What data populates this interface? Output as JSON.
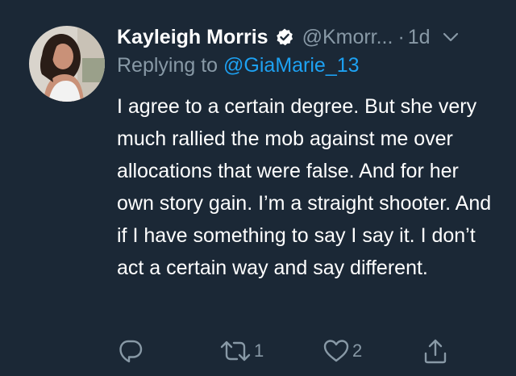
{
  "tweet": {
    "author_name": "Kayleigh Morris",
    "author_handle": "@Kmorr...",
    "separator": "·",
    "timestamp": "1d",
    "replying_prefix": "Replying to",
    "replying_handle": "@GiaMarie_13",
    "text": "I agree to a certain degree. But she very much rallied the mob against me over allocations that were false. And for her own story gain. I’m a straight shooter. And if I have something to say I say it. I don’t act a certain way and say different.",
    "retweet_count": "1",
    "like_count": "2"
  },
  "icons": {
    "verified": "verified-badge-icon",
    "caret": "chevron-down-icon",
    "reply": "reply-icon",
    "retweet": "retweet-icon",
    "like": "heart-icon",
    "share": "share-icon"
  },
  "colors": {
    "background": "#1b2836",
    "secondary_text": "#8899a6",
    "link": "#1da1f2",
    "primary_text": "#ffffff"
  }
}
